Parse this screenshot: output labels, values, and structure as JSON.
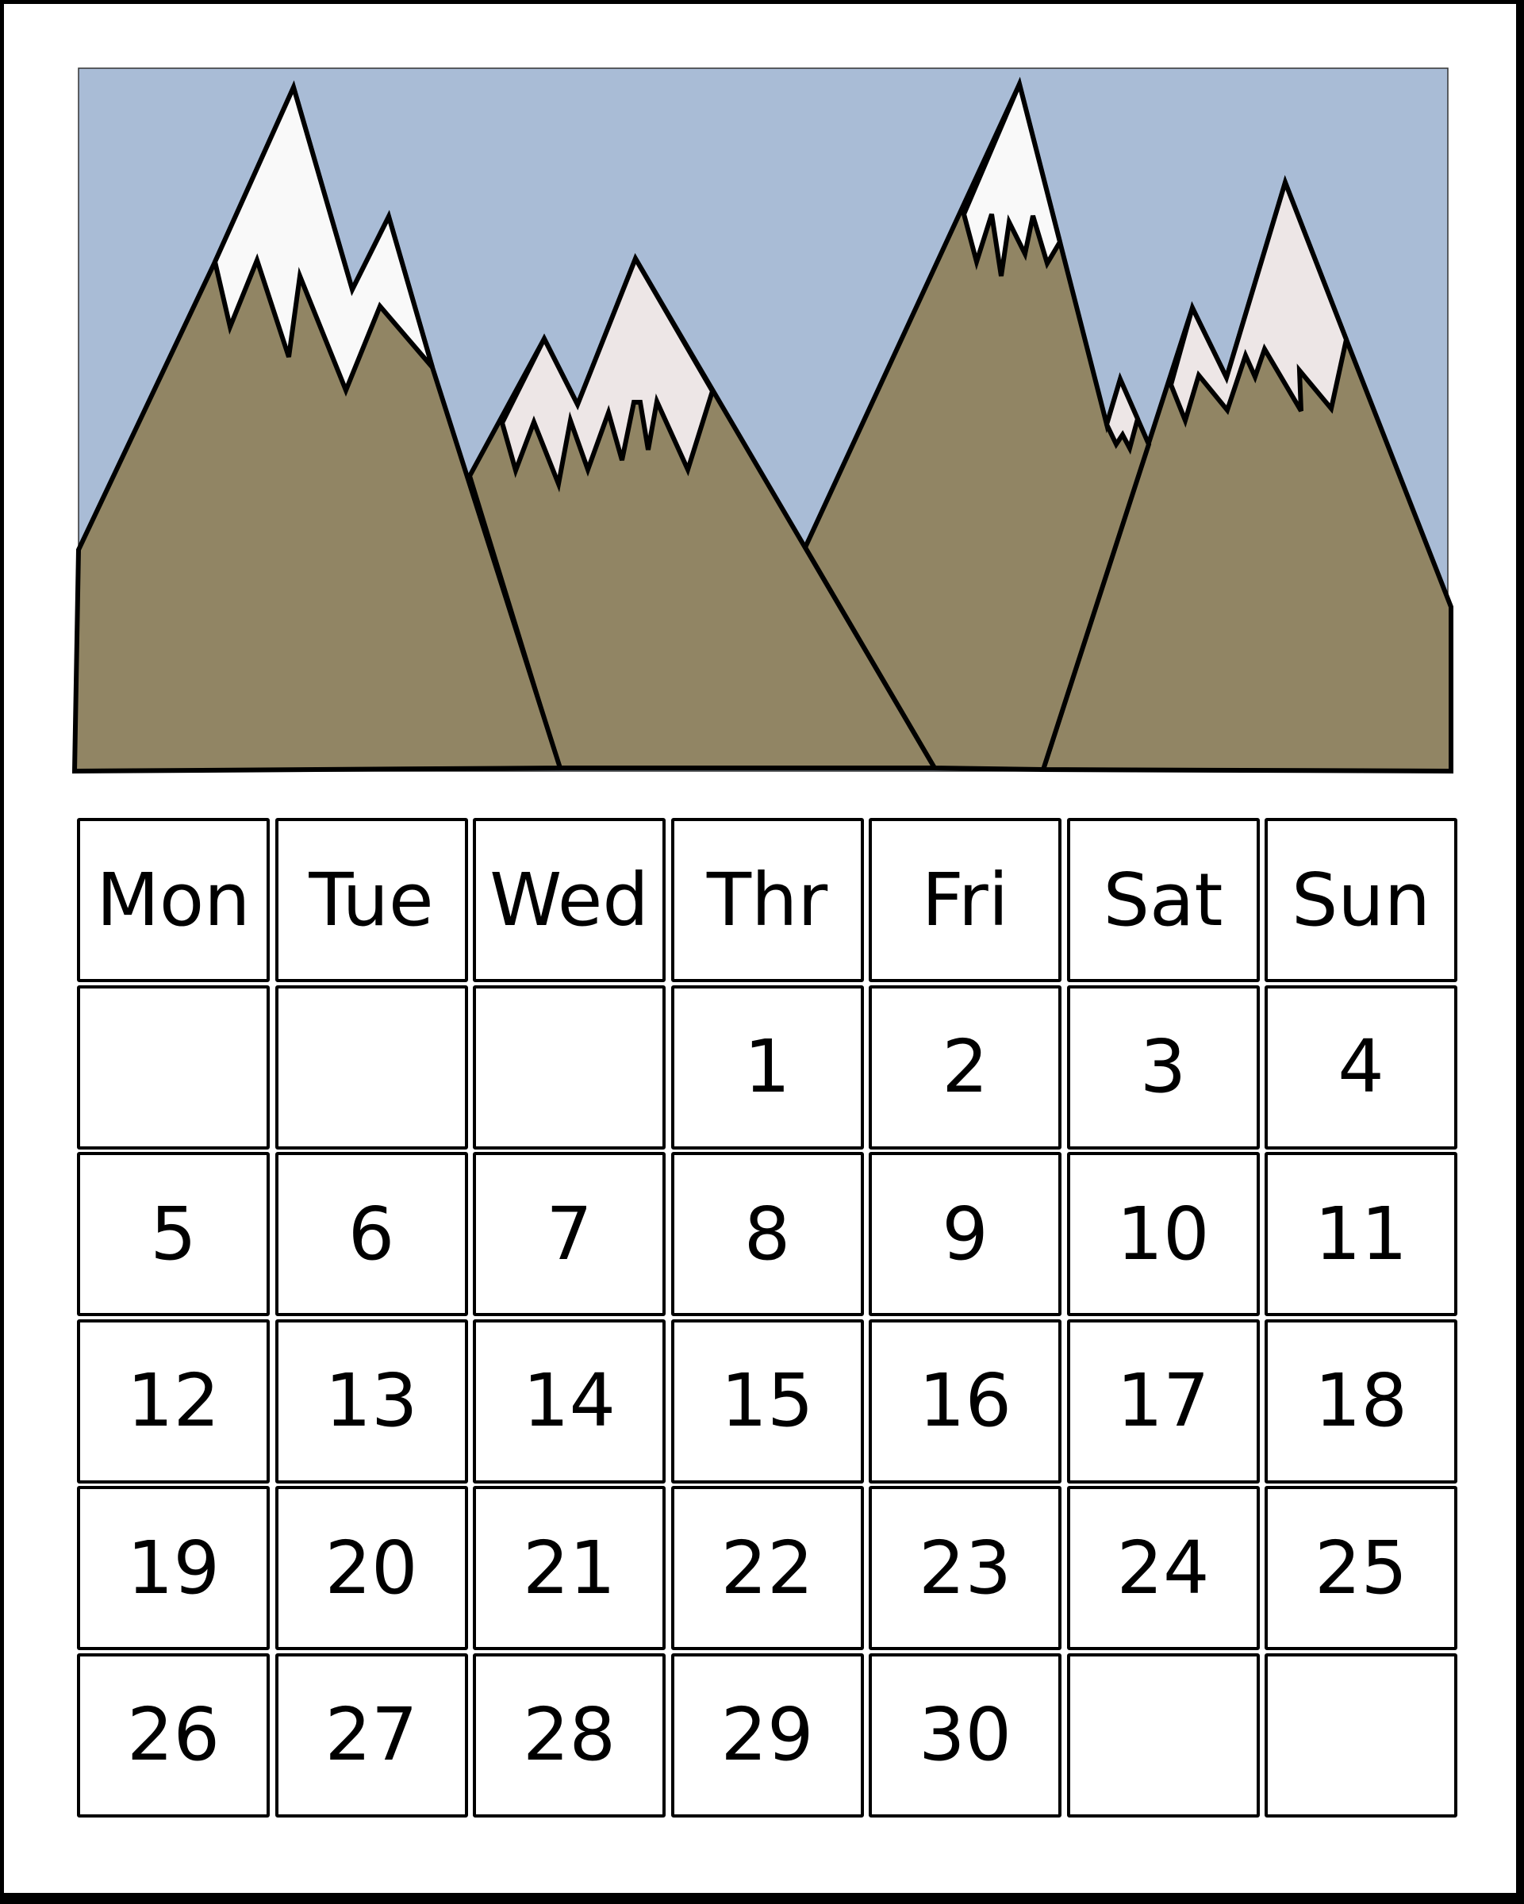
{
  "calendar": {
    "weekdays": [
      "Mon",
      "Tue",
      "Wed",
      "Thr",
      "Fri",
      "Sat",
      "Sun"
    ],
    "weeks": [
      [
        "",
        "",
        "",
        "1",
        "2",
        "3",
        "4"
      ],
      [
        "5",
        "6",
        "7",
        "8",
        "9",
        "10",
        "11"
      ],
      [
        "12",
        "13",
        "14",
        "15",
        "16",
        "17",
        "18"
      ],
      [
        "19",
        "20",
        "21",
        "22",
        "23",
        "24",
        "25"
      ],
      [
        "26",
        "27",
        "28",
        "29",
        "30",
        "",
        ""
      ]
    ]
  },
  "illustration": {
    "subject": "snow-capped mountain range",
    "colors": {
      "sky": "#a9bcd6",
      "mountain": "#918564",
      "snow": "#f9f9f9",
      "snow_pink": "#ede6e6",
      "outline": "#000000"
    }
  }
}
